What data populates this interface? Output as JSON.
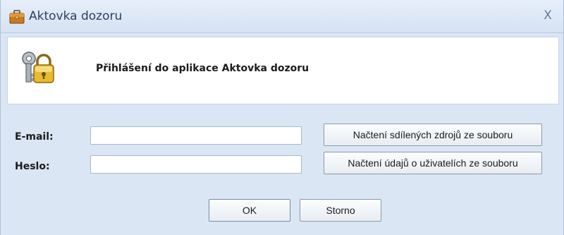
{
  "window": {
    "title": "Aktovka dozoru",
    "close_symbol": "X"
  },
  "header": {
    "text": "Přihlášení do aplikace  Aktovka dozoru",
    "icon": "keys-lock-icon"
  },
  "form": {
    "email_label": "E-mail:",
    "email_value": "",
    "password_label": "Heslo:",
    "password_value": ""
  },
  "buttons": {
    "load_shared_sources": "Načtení sdílených zdrojů ze souboru",
    "load_user_data": "Načtení údajů o uživatelích ze souboru",
    "ok": "OK",
    "cancel": "Storno"
  },
  "colors": {
    "window_bg": "#dbe6f4",
    "panel_bg": "#ffffff",
    "title_text": "#2c3e60"
  }
}
